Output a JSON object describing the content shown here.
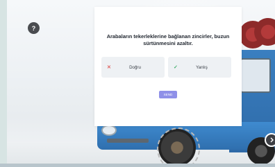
{
  "help": {
    "label": "?"
  },
  "quiz": {
    "question": "Arabaların tekerleklerine bağlanan zincirler, buzun sürtünmesini azaltır.",
    "options": [
      {
        "label": "Doğru",
        "icon": "x-icon",
        "color": "#e0605e"
      },
      {
        "label": "Yanlış",
        "icon": "check-icon",
        "color": "#3fae6a"
      }
    ],
    "submit_label": "SEND"
  },
  "navigation": {
    "next_icon": "chevron-right-icon"
  },
  "colors": {
    "submit": "#8f90e8",
    "truck": "#3a7fc0"
  }
}
